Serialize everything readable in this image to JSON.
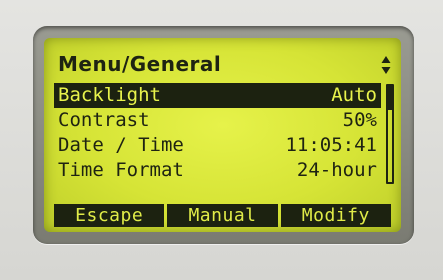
{
  "menu": {
    "title": "Menu/General",
    "scroll_icon": "up-down-arrows-icon"
  },
  "items": [
    {
      "label": "Backlight",
      "value": "Auto",
      "selected": true
    },
    {
      "label": "Contrast",
      "value": "50%",
      "selected": false
    },
    {
      "label": "Date / Time",
      "value": "11:05:41",
      "selected": false
    },
    {
      "label": "Time Format",
      "value": "24-hour",
      "selected": false
    }
  ],
  "softkeys": {
    "left": "Escape",
    "middle": "Manual",
    "right": "Modify"
  },
  "colors": {
    "lcd_background": "#d6e436",
    "lcd_ink": "#1c2210"
  }
}
